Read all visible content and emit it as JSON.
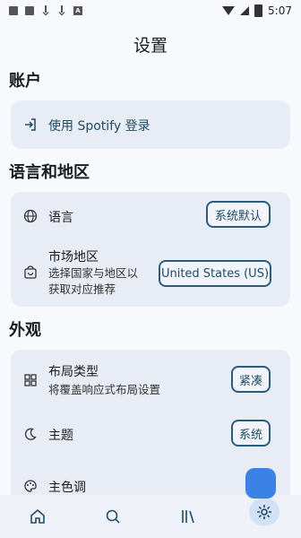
{
  "status_bar": {
    "time": "5:07"
  },
  "page_title": "设置",
  "sections": {
    "account": {
      "title": "账户",
      "login_label": "使用 Spotify 登录"
    },
    "language_region": {
      "title": "语言和地区",
      "language_label": "语言",
      "language_value": "系统默认",
      "market_label": "市场地区",
      "market_sub_1": "选择国家与地区以",
      "market_sub_2": "获取对应推荐",
      "market_value": "United States (US)"
    },
    "appearance": {
      "title": "外观",
      "layout_label": "布局类型",
      "layout_sub": "将覆盖响应式布局设置",
      "layout_value": "紧凑",
      "theme_label": "主题",
      "theme_value": "系统",
      "color_label": "主色调"
    }
  },
  "nav": {
    "items": [
      "home-icon",
      "search-icon",
      "library-icon",
      "settings-icon"
    ],
    "active": "settings"
  },
  "colors": {
    "accent": "#3b82e6",
    "chip_border": "#2b5c7a"
  }
}
